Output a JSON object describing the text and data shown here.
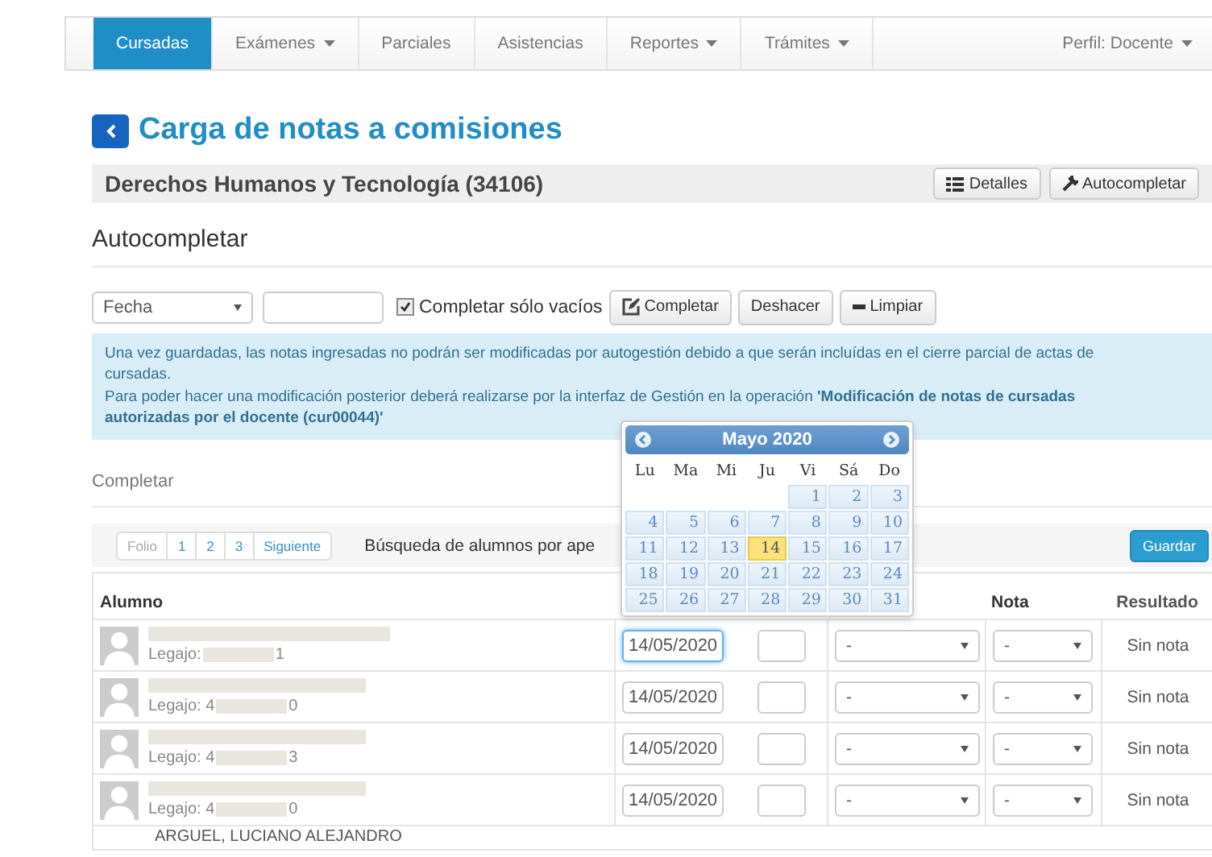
{
  "nav": {
    "tabs": [
      {
        "label": "Cursadas",
        "selected": true,
        "dropdown": false
      },
      {
        "label": "Exámenes",
        "selected": false,
        "dropdown": true
      },
      {
        "label": "Parciales",
        "selected": false,
        "dropdown": false
      },
      {
        "label": "Asistencias",
        "selected": false,
        "dropdown": false
      },
      {
        "label": "Reportes",
        "selected": false,
        "dropdown": true
      },
      {
        "label": "Trámites",
        "selected": false,
        "dropdown": true
      }
    ],
    "profile": "Perfil: Docente"
  },
  "page_title": "Carga de notas a comisiones",
  "subject": {
    "title": "Derechos Humanos y Tecnología (34106)",
    "buttons": [
      {
        "kind": "list",
        "label": "Detalles"
      },
      {
        "kind": "wrench",
        "label": "Autocompletar"
      }
    ]
  },
  "autocomplete": {
    "heading": "Autocompletar",
    "field_select": "Fecha",
    "only_empty": {
      "label": "Completar sólo vacíos",
      "checked": true
    },
    "buttons": [
      {
        "kind": "edit",
        "label": "Completar"
      },
      {
        "kind": "plain",
        "label": "Deshacer"
      },
      {
        "kind": "minus",
        "label": "Limpiar"
      }
    ]
  },
  "info": {
    "line_1": "Una vez guardadas, las notas ingresadas no podrán ser modificadas por autogestión debido a que serán incluídas en el cierre parcial de actas de cursadas.",
    "line_2": "Para poder hacer una modificación posterior deberá realizarse por la interfaz de Gestión en la operación **'Modificación de notas de cursadas autorizadas por el docente (cur00044)'**"
  },
  "complete_heading": "Completar",
  "pagination": {
    "items": [
      {
        "label": "Folio",
        "disabled": true
      },
      {
        "label": "1",
        "disabled": false
      },
      {
        "label": "2",
        "disabled": false
      },
      {
        "label": "3",
        "disabled": false
      },
      {
        "label": "Siguiente",
        "disabled": false
      }
    ],
    "search_label": "Búsqueda de alumnos por ape",
    "save": "Guardar"
  },
  "table": {
    "columns": {
      "student": "Alumno",
      "nota": "Nota",
      "resultado": "Resultado"
    },
    "rows": [
      {
        "legajo": "Legajo:",
        "legajo_tail": "1",
        "date": "14/05/2020",
        "focused": true,
        "condition": "-",
        "nota": "-",
        "result": "Sin nota"
      },
      {
        "legajo": "Legajo: 4",
        "legajo_tail": "0",
        "date": "14/05/2020",
        "focused": false,
        "condition": "-",
        "nota": "-",
        "result": "Sin nota"
      },
      {
        "legajo": "Legajo: 4",
        "legajo_tail": "3",
        "date": "14/05/2020",
        "focused": false,
        "condition": "-",
        "nota": "-",
        "result": "Sin nota"
      },
      {
        "legajo": "Legajo: 4",
        "legajo_tail": "0",
        "date": "14/05/2020",
        "focused": false,
        "condition": "-",
        "nota": "-",
        "result": "Sin nota"
      }
    ],
    "partial_row": {
      "name": "ARGUEL, LUCIANO ALEJANDRO"
    }
  },
  "calendar": {
    "title": "Mayo  2020",
    "weekdays": [
      "Lu",
      "Ma",
      "Mi",
      "Ju",
      "Vi",
      "Sá",
      "Do"
    ],
    "weeks": [
      [
        {
          "kind": "blank"
        },
        {
          "kind": "blank"
        },
        {
          "kind": "blank"
        },
        {
          "kind": "blank"
        },
        {
          "d": "1",
          "selected": false
        },
        {
          "d": "2",
          "selected": false
        },
        {
          "d": "3",
          "selected": false
        }
      ],
      [
        {
          "d": "4",
          "selected": false
        },
        {
          "d": "5",
          "selected": false
        },
        {
          "d": "6",
          "selected": false
        },
        {
          "d": "7",
          "selected": false
        },
        {
          "d": "8",
          "selected": false
        },
        {
          "d": "9",
          "selected": false
        },
        {
          "d": "10",
          "selected": false
        }
      ],
      [
        {
          "d": "11",
          "selected": false
        },
        {
          "d": "12",
          "selected": false
        },
        {
          "d": "13",
          "selected": false
        },
        {
          "d": "14",
          "selected": true
        },
        {
          "d": "15",
          "selected": false
        },
        {
          "d": "16",
          "selected": false
        },
        {
          "d": "17",
          "selected": false
        }
      ],
      [
        {
          "d": "18",
          "selected": false
        },
        {
          "d": "19",
          "selected": false
        },
        {
          "d": "20",
          "selected": false
        },
        {
          "d": "21",
          "selected": false
        },
        {
          "d": "22",
          "selected": false
        },
        {
          "d": "23",
          "selected": false
        },
        {
          "d": "24",
          "selected": false
        }
      ],
      [
        {
          "d": "25",
          "selected": false
        },
        {
          "d": "26",
          "selected": false
        },
        {
          "d": "27",
          "selected": false
        },
        {
          "d": "28",
          "selected": false
        },
        {
          "d": "29",
          "selected": false
        },
        {
          "d": "30",
          "selected": false
        },
        {
          "d": "31",
          "selected": false
        }
      ]
    ]
  }
}
